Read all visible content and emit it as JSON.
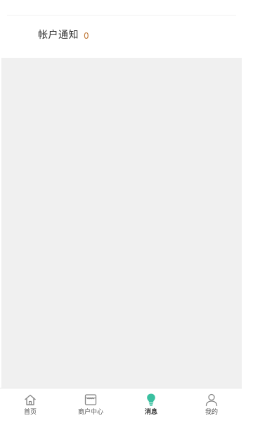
{
  "notice": {
    "label": "帐户通知",
    "count": "0"
  },
  "tabbar": {
    "active_color": "#3ac0a0",
    "items": [
      {
        "label": "首页",
        "icon": "home-icon"
      },
      {
        "label": "商户中心",
        "icon": "store-icon"
      },
      {
        "label": "消息",
        "icon": "bulb-icon"
      },
      {
        "label": "我的",
        "icon": "user-icon"
      }
    ]
  }
}
